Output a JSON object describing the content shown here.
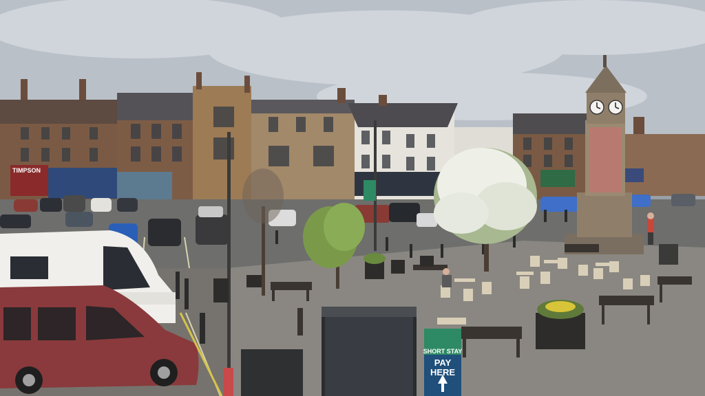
{
  "scene": {
    "sky_color": "#b9c0c8",
    "cloud_color": "#d6dae0",
    "road_color": "#6e6e6c",
    "paving_color": "#8a8782",
    "brick_color": "#7a5a44",
    "stone_color": "#a2896a",
    "white_facade": "#e6e3dc",
    "tree_blossom": "#eef0e8",
    "tree_leaf": "#7a9a4a",
    "clock_tower_color": "#8f7f6a",
    "sign_green": "#2e8a64",
    "sign_blue": "#1f4f7a"
  },
  "shops": {
    "left": "TIMPSON",
    "second": "",
    "third": "",
    "right": ""
  },
  "sign": {
    "top": "SHORT STAY",
    "main_line1": "PAY",
    "main_line2": "HERE"
  }
}
